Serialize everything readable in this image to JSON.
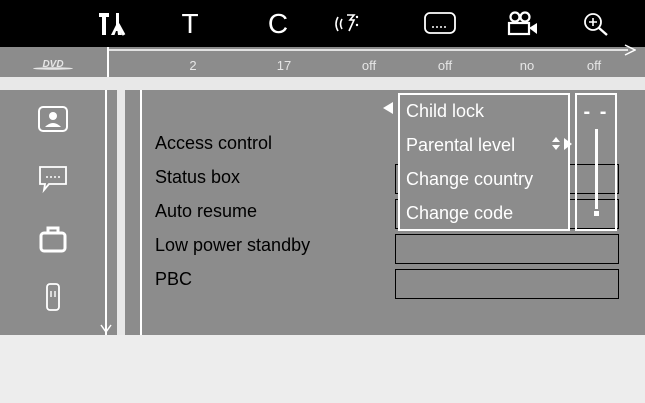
{
  "top_menu": {
    "icons": [
      {
        "name": "settings-tools-icon",
        "active": true
      },
      {
        "name": "title-icon",
        "glyph": "T"
      },
      {
        "name": "chapter-icon",
        "glyph": "C"
      },
      {
        "name": "audio-icon"
      },
      {
        "name": "subtitle-icon"
      },
      {
        "name": "camera-angle-icon"
      },
      {
        "name": "zoom-icon"
      }
    ]
  },
  "status": {
    "logo": "DVD",
    "values": [
      "2",
      "17",
      "off",
      "off",
      "no",
      "off"
    ]
  },
  "sidebar": {
    "items": [
      {
        "name": "picture-settings-icon"
      },
      {
        "name": "subtitle-settings-icon"
      },
      {
        "name": "features-icon",
        "active": true
      },
      {
        "name": "remote-icon"
      }
    ]
  },
  "settings": {
    "items": [
      "Access control",
      "Status box",
      "Auto resume",
      "Low power standby",
      "PBC"
    ]
  },
  "popup": {
    "items": [
      "Child lock",
      "Parental level",
      "Change country",
      "Change code"
    ],
    "selected_index": 0,
    "slider_label": "- -"
  },
  "colors": {
    "top_bar": "#000000",
    "panel": "#8c8c8c",
    "text_dark": "#000000",
    "text_light": "#ffffff"
  }
}
